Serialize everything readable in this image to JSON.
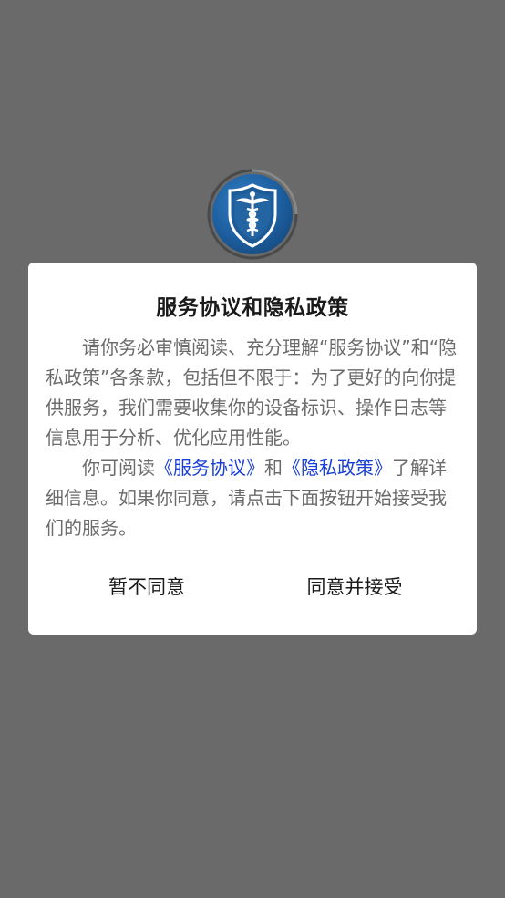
{
  "background_color": "#6a6a6a",
  "logo": {
    "icon": "caduceus-shield-icon",
    "disc_color": "#1c5c9c"
  },
  "dialog": {
    "title": "服务协议和隐私政策",
    "paragraph1": "请你务必审慎阅读、充分理解“服务协议”和“隐私政策”各条款，包括但不限于：为了更好的向你提供服务，我们需要收集你的设备标识、操作日志等信息用于分析、优化应用性能。",
    "paragraph2_prefix": "你可阅读",
    "link_service": "《服务协议》",
    "paragraph2_and": "和",
    "link_privacy": "《隐私政策》",
    "paragraph2_suffix": "了解详细信息。如果你同意，请点击下面按钮开始接受我们的服务。",
    "link_color": "#1a3fd6",
    "decline_label": "暂不同意",
    "accept_label": "同意并接受"
  }
}
